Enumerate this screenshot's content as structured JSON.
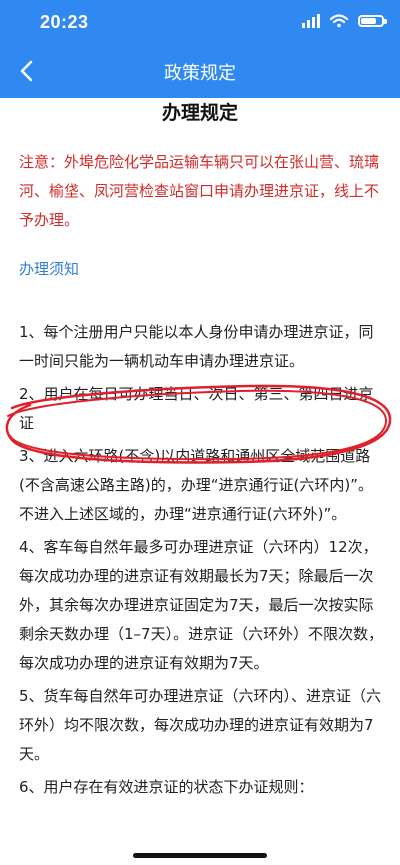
{
  "status_bar": {
    "time": "20:23",
    "battery_level": 0.75
  },
  "nav": {
    "title": "政策规定"
  },
  "page": {
    "title": "办理规定",
    "notice": "注意：外埠危险化学品运输车辆只可以在张山营、琉璃河、榆垡、凤河营检查站窗口申请办理进京证，线上不予办理。",
    "section_heading": "办理须知",
    "rules": [
      "1、每个注册用户只能以本人身份申请办理进京证，同一时间只能为一辆机动车申请办理进京证。",
      "2、用户在每日可办理当日、次日、第三、第四日进京证",
      "3、进入六环路(不含)以内道路和通州区全域范围道路(不含高速公路主路)的，办理“进京通行证(六环内)”。不进入上述区域的，办理“进京通行证(六环外)”。",
      "4、客车每自然年最多可办理进京证（六环内）12次，每次成功办理的进京证有效期最长为7天；除最后一次外，其余每次办理进京证固定为7天，最后一次按实际剩余天数办理（1–7天）。进京证（六环外）不限次数，每次成功办理的进京证有效期为7天。",
      "5、货车每自然年可办理进京证（六环内）、进京证（六环外）均不限次数，每次成功办理的进京证有效期为7天。",
      "6、用户存在有效进京证的状态下办证规则："
    ]
  },
  "colors": {
    "primary": "#2f89f0",
    "notice": "#d42a2a",
    "link": "#2f7fd6",
    "annotation": "#e0202a"
  },
  "icons": {
    "back": "chevron-left-icon",
    "signal": "signal-icon",
    "wifi": "wifi-icon",
    "battery": "battery-icon"
  }
}
